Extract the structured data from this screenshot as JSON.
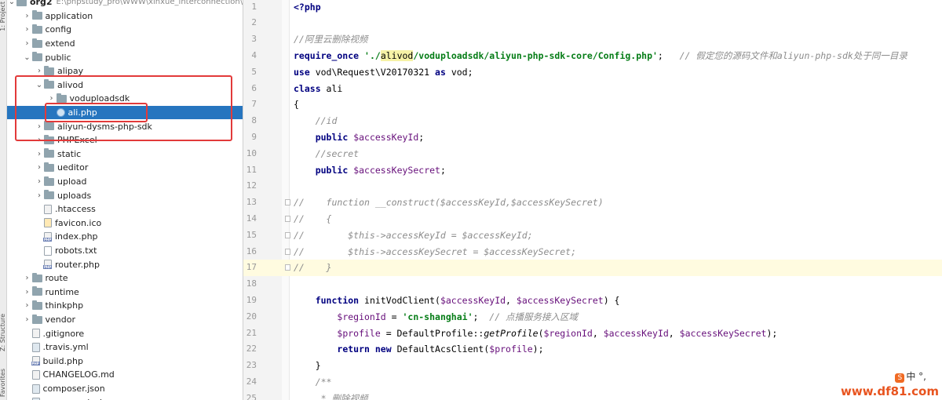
{
  "sidebar": {
    "strip_labels": [
      "1: Project",
      "Z: Structure",
      "Favorites"
    ],
    "root": {
      "label": "org2",
      "path": "E:\\phpstudy_pro\\WWW\\xinxue_interconnection\\"
    },
    "items": [
      {
        "label": "application",
        "type": "folder",
        "depth": 1,
        "expanded": false
      },
      {
        "label": "config",
        "type": "folder",
        "depth": 1,
        "expanded": false
      },
      {
        "label": "extend",
        "type": "folder",
        "depth": 1,
        "expanded": false
      },
      {
        "label": "public",
        "type": "folder",
        "depth": 1,
        "expanded": true
      },
      {
        "label": "alipay",
        "type": "folder",
        "depth": 2,
        "expanded": false
      },
      {
        "label": "alivod",
        "type": "folder",
        "depth": 2,
        "expanded": true
      },
      {
        "label": "voduploadsdk",
        "type": "folder",
        "depth": 3,
        "expanded": false
      },
      {
        "label": "ali.php",
        "type": "php-class",
        "depth": 3,
        "selected": true
      },
      {
        "label": "aliyun-dysms-php-sdk",
        "type": "folder",
        "depth": 2,
        "expanded": false
      },
      {
        "label": "PHPExcel",
        "type": "folder",
        "depth": 2,
        "expanded": false
      },
      {
        "label": "static",
        "type": "folder",
        "depth": 2,
        "expanded": false
      },
      {
        "label": "ueditor",
        "type": "folder",
        "depth": 2,
        "expanded": false
      },
      {
        "label": "upload",
        "type": "folder",
        "depth": 2,
        "expanded": false
      },
      {
        "label": "uploads",
        "type": "folder",
        "depth": 2,
        "expanded": false
      },
      {
        "label": ".htaccess",
        "type": "file",
        "depth": 2
      },
      {
        "label": "favicon.ico",
        "type": "ico",
        "depth": 2
      },
      {
        "label": "index.php",
        "type": "php",
        "depth": 2
      },
      {
        "label": "robots.txt",
        "type": "txt",
        "depth": 2
      },
      {
        "label": "router.php",
        "type": "php",
        "depth": 2
      },
      {
        "label": "route",
        "type": "folder",
        "depth": 1,
        "expanded": false
      },
      {
        "label": "runtime",
        "type": "folder",
        "depth": 1,
        "expanded": false
      },
      {
        "label": "thinkphp",
        "type": "folder",
        "depth": 1,
        "expanded": false
      },
      {
        "label": "vendor",
        "type": "folder",
        "depth": 1,
        "expanded": false
      },
      {
        "label": ".gitignore",
        "type": "file",
        "depth": 1
      },
      {
        "label": ".travis.yml",
        "type": "cfg",
        "depth": 1
      },
      {
        "label": "build.php",
        "type": "php",
        "depth": 1
      },
      {
        "label": "CHANGELOG.md",
        "type": "md",
        "depth": 1
      },
      {
        "label": "composer.json",
        "type": "cfg",
        "depth": 1
      },
      {
        "label": "composer.lock",
        "type": "cfg",
        "depth": 1
      }
    ]
  },
  "editor": {
    "highlighted_line": 17,
    "lines": [
      {
        "n": "1",
        "t": [
          [
            "kw",
            "<?php"
          ]
        ]
      },
      {
        "n": "2",
        "t": []
      },
      {
        "n": "3",
        "t": [
          [
            "cmt",
            "//阿里云删除视频"
          ]
        ]
      },
      {
        "n": "4",
        "t": [
          [
            "kw",
            "require_once"
          ],
          [
            "",
            " "
          ],
          [
            "str",
            "'./"
          ],
          [
            "strhl",
            "alivod"
          ],
          [
            "str",
            "/voduploadsdk/aliyun-php-sdk-core/Config.php'"
          ],
          [
            "",
            ";   "
          ],
          [
            "cmt",
            "// 假定您的源码文件和aliyun-php-sdk处于同一目录"
          ]
        ]
      },
      {
        "n": "5",
        "t": [
          [
            "kw",
            "use"
          ],
          [
            "",
            " vod\\Request\\V20170321 "
          ],
          [
            "kw",
            "as"
          ],
          [
            "",
            " vod;"
          ]
        ]
      },
      {
        "n": "6",
        "t": [
          [
            "kw",
            "class"
          ],
          [
            "",
            " ali"
          ]
        ]
      },
      {
        "n": "7",
        "t": [
          [
            "",
            "{"
          ]
        ]
      },
      {
        "n": "8",
        "t": [
          [
            "",
            "    "
          ],
          [
            "cmt",
            "//id"
          ]
        ]
      },
      {
        "n": "9",
        "t": [
          [
            "",
            "    "
          ],
          [
            "kw",
            "public"
          ],
          [
            "",
            " "
          ],
          [
            "var",
            "$accessKeyId"
          ],
          [
            "",
            ";"
          ]
        ]
      },
      {
        "n": "10",
        "t": [
          [
            "",
            "    "
          ],
          [
            "cmt",
            "//secret"
          ]
        ]
      },
      {
        "n": "11",
        "t": [
          [
            "",
            "    "
          ],
          [
            "kw",
            "public"
          ],
          [
            "",
            " "
          ],
          [
            "var",
            "$accessKeySecret"
          ],
          [
            "",
            ";"
          ]
        ]
      },
      {
        "n": "12",
        "t": []
      },
      {
        "n": "13",
        "t": [
          [
            "cmt",
            "//    function __construct($accessKeyId,$accessKeySecret)"
          ]
        ]
      },
      {
        "n": "14",
        "t": [
          [
            "cmt",
            "//    {"
          ]
        ]
      },
      {
        "n": "15",
        "t": [
          [
            "cmt",
            "//        $this->accessKeyId = $accessKeyId;"
          ]
        ]
      },
      {
        "n": "16",
        "t": [
          [
            "cmt",
            "//        $this->accessKeySecret = $accessKeySecret;"
          ]
        ]
      },
      {
        "n": "17",
        "t": [
          [
            "cmt",
            "//    }"
          ]
        ]
      },
      {
        "n": "18",
        "t": []
      },
      {
        "n": "19",
        "t": [
          [
            "",
            "    "
          ],
          [
            "kw",
            "function"
          ],
          [
            "",
            " initVodClient("
          ],
          [
            "var",
            "$accessKeyId"
          ],
          [
            "",
            ", "
          ],
          [
            "var",
            "$accessKeySecret"
          ],
          [
            "",
            ") {"
          ]
        ]
      },
      {
        "n": "20",
        "t": [
          [
            "",
            "        "
          ],
          [
            "var",
            "$regionId"
          ],
          [
            "",
            " = "
          ],
          [
            "str",
            "'cn-shanghai'"
          ],
          [
            "",
            ";  "
          ],
          [
            "cmt",
            "// 点播服务接入区域"
          ]
        ]
      },
      {
        "n": "21",
        "t": [
          [
            "",
            "        "
          ],
          [
            "var",
            "$profile"
          ],
          [
            "",
            " = DefaultProfile::"
          ],
          [
            "fn",
            "getProfile"
          ],
          [
            "",
            "("
          ],
          [
            "var",
            "$regionId"
          ],
          [
            "",
            ", "
          ],
          [
            "var",
            "$accessKeyId"
          ],
          [
            "",
            ", "
          ],
          [
            "var",
            "$accessKeySecret"
          ],
          [
            "",
            ");"
          ]
        ]
      },
      {
        "n": "22",
        "t": [
          [
            "",
            "        "
          ],
          [
            "kw",
            "return"
          ],
          [
            "",
            " "
          ],
          [
            "kw",
            "new"
          ],
          [
            "",
            " DefaultAcsClient("
          ],
          [
            "var",
            "$profile"
          ],
          [
            "",
            ");"
          ]
        ]
      },
      {
        "n": "23",
        "t": [
          [
            "",
            "    }"
          ]
        ]
      },
      {
        "n": "24",
        "t": [
          [
            "",
            "    "
          ],
          [
            "cmt",
            "/**"
          ]
        ]
      },
      {
        "n": "25",
        "t": [
          [
            "",
            "     "
          ],
          [
            "cmt",
            "* 删除视频"
          ]
        ]
      }
    ]
  },
  "overlay": {
    "watermark": "www.df81.com",
    "ime": "中 °,"
  }
}
